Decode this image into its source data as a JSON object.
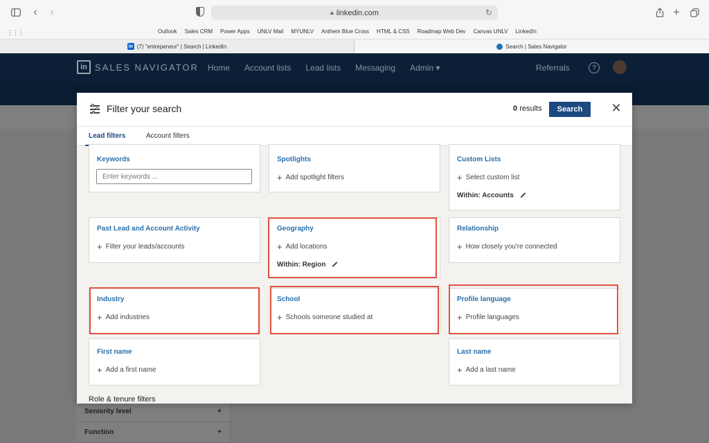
{
  "browser": {
    "url": "linkedin.com",
    "favorites": [
      "Outlook",
      "Sales CRM",
      "Power Apps",
      "UNLV Mail",
      "MYUNLV",
      "Anthem Blue Cross",
      "HTML & CSS",
      "Roadmap Web Dev",
      "Canvas UNLV",
      "LinkedIn"
    ],
    "tabs": [
      {
        "label": "(7) \"entrepeneur\" | Search | LinkedIn"
      },
      {
        "label": "Search | Sales Navigator"
      }
    ]
  },
  "sn_header": {
    "brand": "SALES NAVIGATOR",
    "nav": [
      "Home",
      "Account lists",
      "Lead lists",
      "Messaging",
      "Admin ▾"
    ],
    "referrals": "Referrals"
  },
  "sidebar": {
    "items": [
      {
        "label": "Seniority level"
      },
      {
        "label": "Function"
      }
    ]
  },
  "modal": {
    "title": "Filter your search",
    "results_count": "0",
    "results_label": "results",
    "search_label": "Search",
    "tabs": [
      {
        "label": "Lead filters"
      },
      {
        "label": "Account filters"
      }
    ],
    "cards": {
      "keywords": {
        "title": "Keywords",
        "placeholder": "Enter keywords ..."
      },
      "spotlights": {
        "title": "Spotlights",
        "add": "Add spotlight filters"
      },
      "custom_lists": {
        "title": "Custom Lists",
        "add": "Select custom list",
        "within": "Within: Accounts"
      },
      "past_activity": {
        "title": "Past Lead and Account Activity",
        "add": "Filter your leads/accounts"
      },
      "geography": {
        "title": "Geography",
        "add": "Add locations",
        "within": "Within: Region"
      },
      "relationship": {
        "title": "Relationship",
        "add": "How closely you're connected"
      },
      "industry": {
        "title": "Industry",
        "add": "Add industries"
      },
      "school": {
        "title": "School",
        "add": "Schools someone studied at"
      },
      "profile_language": {
        "title": "Profile language",
        "add": "Profile languages"
      },
      "first_name": {
        "title": "First name",
        "add": "Add a first name"
      },
      "last_name": {
        "title": "Last name",
        "add": "Add a last name"
      }
    },
    "section_label": "Role & tenure filters"
  },
  "colors": {
    "accent_blue": "#1d4a80",
    "title_blue": "#2a6fab",
    "highlight_red": "#e0513f",
    "sn_navy": "#0b2036"
  }
}
